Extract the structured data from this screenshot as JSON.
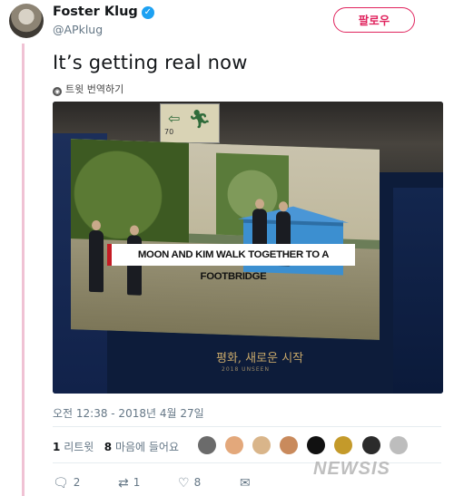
{
  "user": {
    "name": "Foster Klug",
    "handle": "@APklug",
    "follow_label": "팔로우"
  },
  "tweet": {
    "text": "It’s getting real now",
    "translate_label": "트윗 번역하기",
    "timestamp": "오전 12:38 - 2018년 4월 27일"
  },
  "photo": {
    "caption": "MOON AND KIM WALK TOGETHER TO A FOOTBRIDGE",
    "banner_korean": "평화, 새로운 시작",
    "banner_sub": "2018 UNSEEN",
    "exit_sign_number": "70"
  },
  "stats": {
    "retweets_count": "1",
    "retweets_label": "리트윗",
    "likes_count": "8",
    "likes_label": "마음에 들어요"
  },
  "liker_colors": [
    "#6b6b6b",
    "#e3a87b",
    "#d9b58a",
    "#c98a5c",
    "#111111",
    "#c49a2a",
    "#2b2b2b",
    "#bdbdbd"
  ],
  "actions": {
    "reply_count": "2",
    "retweet_count": "1",
    "like_count": "8"
  },
  "watermark": "NEWSIS",
  "colors": {
    "accent": "#e0245e",
    "verified": "#1da1f2",
    "caption_bar": "#c51b24"
  }
}
